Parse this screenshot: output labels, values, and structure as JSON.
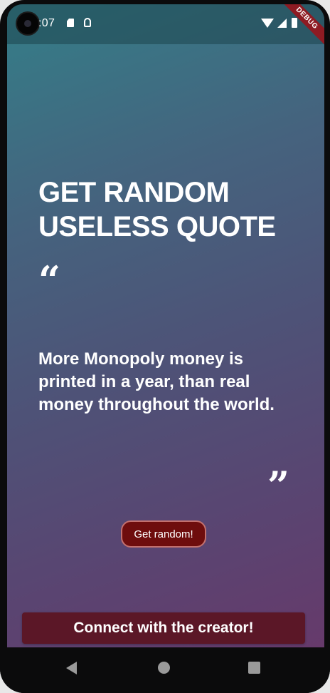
{
  "status_bar": {
    "time": ":07",
    "debug_banner": "DEBUG",
    "icons": [
      "sd-card-icon",
      "android-debug-icon",
      "wifi-icon",
      "cell-signal-icon",
      "battery-icon"
    ]
  },
  "main": {
    "title": "GET RANDOM USELESS QUOTE",
    "open_quote_mark": "“",
    "quote": "More Monopoly money is printed in a year, than real money throughout the world.",
    "close_quote_mark": "”",
    "random_button_label": "Get random!"
  },
  "footer": {
    "connect_button_label": "Connect with the creator!"
  },
  "nav_bar": {
    "icons": [
      "back-icon",
      "home-icon",
      "recent-apps-icon"
    ]
  },
  "colors": {
    "gradient_top": "#347e88",
    "gradient_bottom": "#663a6b",
    "random_button_bg": "#6e0d0d",
    "random_button_border": "#c2706e",
    "connect_button_bg": "#5b1727",
    "debug_banner": "#8e1b23"
  }
}
